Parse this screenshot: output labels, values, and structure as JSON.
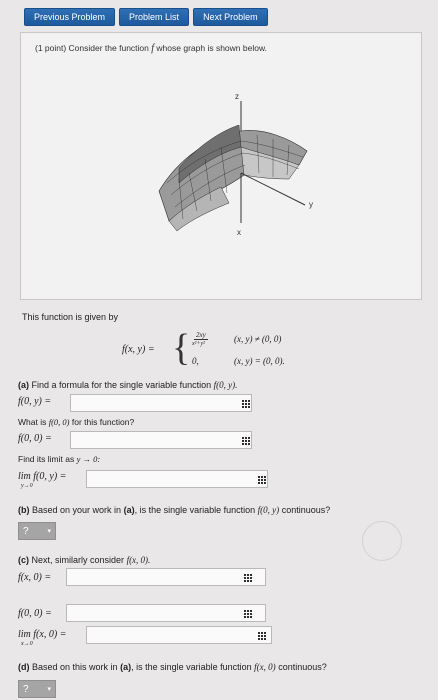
{
  "nav": {
    "previous_label": "Previous Problem",
    "list_label": "Problem List",
    "next_label": "Next Problem"
  },
  "problem": {
    "intro_prefix": "(1 point) Consider the function",
    "intro_fn": "f",
    "intro_suffix": "whose graph is shown below.",
    "axis_z": "z",
    "axis_y": "y",
    "axis_x": "x"
  },
  "definition": {
    "lead": "This function is given by",
    "lhs": "f(x, y) =",
    "frac_num": "2xy",
    "frac_den": "x²+y²",
    "case1_cond": "(x, y) ≠ (0, 0)",
    "case2_val": "0,",
    "case2_cond": "(x, y) = (0, 0)."
  },
  "part_a": {
    "label": "(a)",
    "text": "Find a formula for the single variable function",
    "fn": "f(0, y).",
    "row1_label": "f(0, y) =",
    "q2_prefix": "What is",
    "q2_fn": "f(0, 0)",
    "q2_suffix": "for this function?",
    "row2_label": "f(0, 0) =",
    "q3_text": "Find its limit as",
    "q3_var": "y → 0:",
    "row3_label": "lim f(0, y) =",
    "row3_sub": "y→0"
  },
  "part_b": {
    "label": "(b)",
    "text": "Based on your work in",
    "ref": "(a)",
    "text2": ", is the single variable function",
    "fn": "f(0, y)",
    "text3": "continuous?",
    "select_value": "?"
  },
  "part_c": {
    "label": "(c)",
    "text": "Next, similarly consider",
    "fn": "f(x, 0).",
    "row1_label": "f(x, 0) =",
    "row2_label": "f(0, 0) =",
    "row3_label": "lim f(x, 0) =",
    "row3_sub": "x→0"
  },
  "part_d": {
    "label": "(d)",
    "text": "Based on this work in",
    "ref": "(a)",
    "text2": ", is the single variable function",
    "fn": "f(x, 0)",
    "text3": "continuous?",
    "select_value": "?"
  }
}
